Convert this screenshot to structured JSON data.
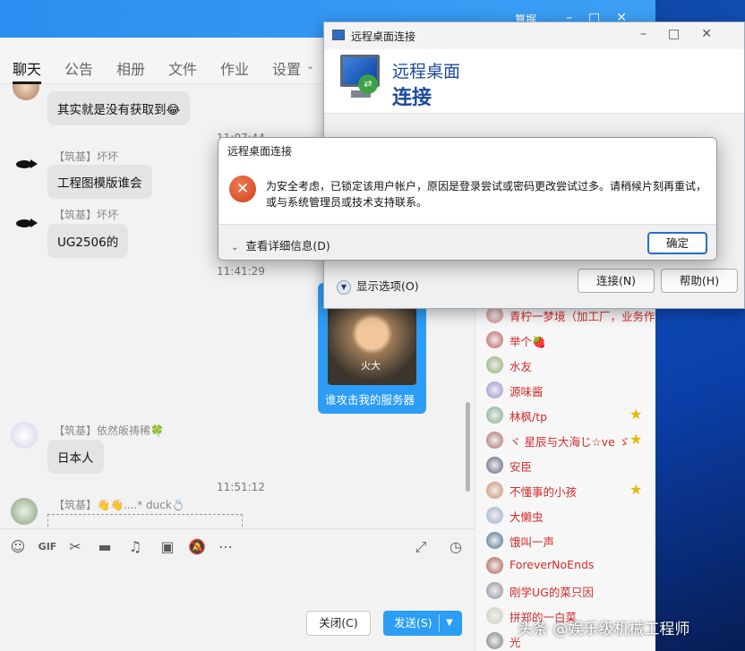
{
  "qq": {
    "titlebar_name": "算据",
    "tabs": [
      {
        "label": "聊天"
      },
      {
        "label": "公告"
      },
      {
        "label": "相册"
      },
      {
        "label": "文件"
      },
      {
        "label": "作业"
      },
      {
        "label": "设置"
      }
    ],
    "messages": {
      "m1_text": "其实就是没有获取到😂",
      "t1": "11:07:44",
      "m2_sender": "【筑基】坏坏",
      "m2_text": "工程图模版谁会",
      "m3_sender": "【筑基】坏坏",
      "m3_text": "UG2506的",
      "t2": "11:41:29",
      "img_label": "火大",
      "img_caption": "谁攻击我的服务器",
      "m4_sender": "【筑基】依然皈祷稀🍀",
      "m4_text": "日本人",
      "t3": "11:51:12",
      "m5_sender": "【筑基】👋👋....* duck💍"
    },
    "toolbar": {
      "gif": "GIF"
    },
    "buttons": {
      "close": "关闭(C)",
      "send": "发送(S)"
    },
    "members": [
      {
        "name": "青柠一梦境（加工厂，业务作",
        "star": false
      },
      {
        "name": "举个🍓",
        "star": false
      },
      {
        "name": "水友",
        "star": false
      },
      {
        "name": "源味酱",
        "star": false
      },
      {
        "name": "林枫/tp",
        "star": true
      },
      {
        "name": "ヾ 星辰与大海じ☆ve ゞ",
        "star": true
      },
      {
        "name": "安臣",
        "star": false
      },
      {
        "name": "不懂事的小孩",
        "star": true
      },
      {
        "name": "大懒虫",
        "star": false
      },
      {
        "name": "饿叫一声",
        "star": false
      },
      {
        "name": "ForeverNoEnds",
        "star": false
      },
      {
        "name": "刚学UG的菜只因",
        "star": false
      },
      {
        "name": "拼郑的一白菜",
        "star": false
      },
      {
        "name": "光",
        "star": false
      }
    ],
    "star_glyph": "★"
  },
  "rdp": {
    "window_title": "远程桌面连接",
    "banner_line1": "远程桌面",
    "banner_line2": "连接",
    "show_options": "显示选项(O)",
    "connect": "连接(N)",
    "help": "帮助(H)"
  },
  "error_dialog": {
    "title": "远程桌面连接",
    "message": "为安全考虑，已锁定该用户帐户，原因是登录尝试或密码更改尝试过多。请稍候片刻再重试，或与系统管理员或技术支持联系。",
    "details": "查看详细信息(D)",
    "ok": "确定"
  },
  "watermark": "头条 @娱乐级机械工程师",
  "colors": {
    "accent": "#2b9df4",
    "member_name": "#d32b2b",
    "error_icon": "#d0401e"
  }
}
